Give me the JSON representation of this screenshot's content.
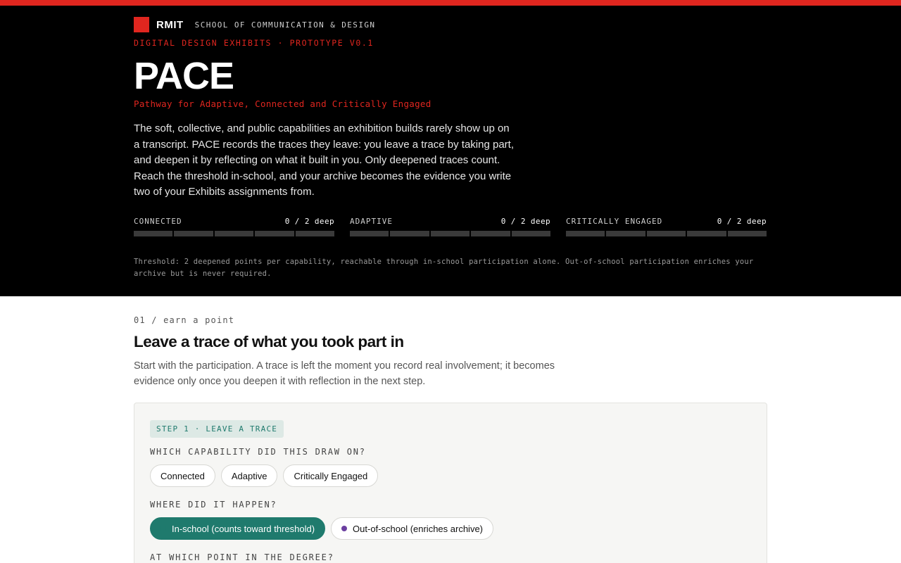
{
  "brand": {
    "logo_text": "RMIT",
    "school": "SCHOOL OF COMMUNICATION & DESIGN"
  },
  "hero": {
    "eyebrow": "DIGITAL DESIGN EXHIBITS · PROTOTYPE V0.1",
    "title": "PACE",
    "subtitle": "Pathway for Adaptive, Connected and Critically Engaged",
    "intro": "The soft, collective, and public capabilities an exhibition builds rarely show up on a transcript. PACE records the traces they leave: you leave a trace by taking part, and deepen it by reflecting on what it built in you. Only deepened traces count. Reach the threshold in-school, and your archive becomes the evidence you write two of your Exhibits assignments from.",
    "threshold_note": "Threshold: 2 deepened points per capability, reachable through in-school participation alone. Out-of-school participation enriches your archive but is never required."
  },
  "meters": [
    {
      "name": "CONNECTED",
      "value": "0 / 2 deep",
      "progress": 0
    },
    {
      "name": "ADAPTIVE",
      "value": "0 / 2 deep",
      "progress": 0
    },
    {
      "name": "CRITICALLY ENGAGED",
      "value": "0 / 2 deep",
      "progress": 0
    }
  ],
  "section": {
    "kicker": "01 / earn a point",
    "heading": "Leave a trace of what you took part in",
    "lead": "Start with the participation. A trace is left the moment you record real involvement; it becomes evidence only once you deepen it with reflection in the next step."
  },
  "form": {
    "step_badge": "STEP 1 · LEAVE A TRACE",
    "q_capability": "WHICH CAPABILITY DID THIS DRAW ON?",
    "capability_options": [
      "Connected",
      "Adaptive",
      "Critically Engaged"
    ],
    "q_where": "WHERE DID IT HAPPEN?",
    "where_options": [
      "In-school (counts toward threshold)",
      "Out-of-school (enriches archive)"
    ],
    "where_selected": "In-school (counts toward threshold)",
    "q_when": "AT WHICH POINT IN THE DEGREE?"
  },
  "colors": {
    "accent_red": "#e0261f",
    "teal": "#1f7a6d",
    "purple": "#6b3fa0"
  }
}
